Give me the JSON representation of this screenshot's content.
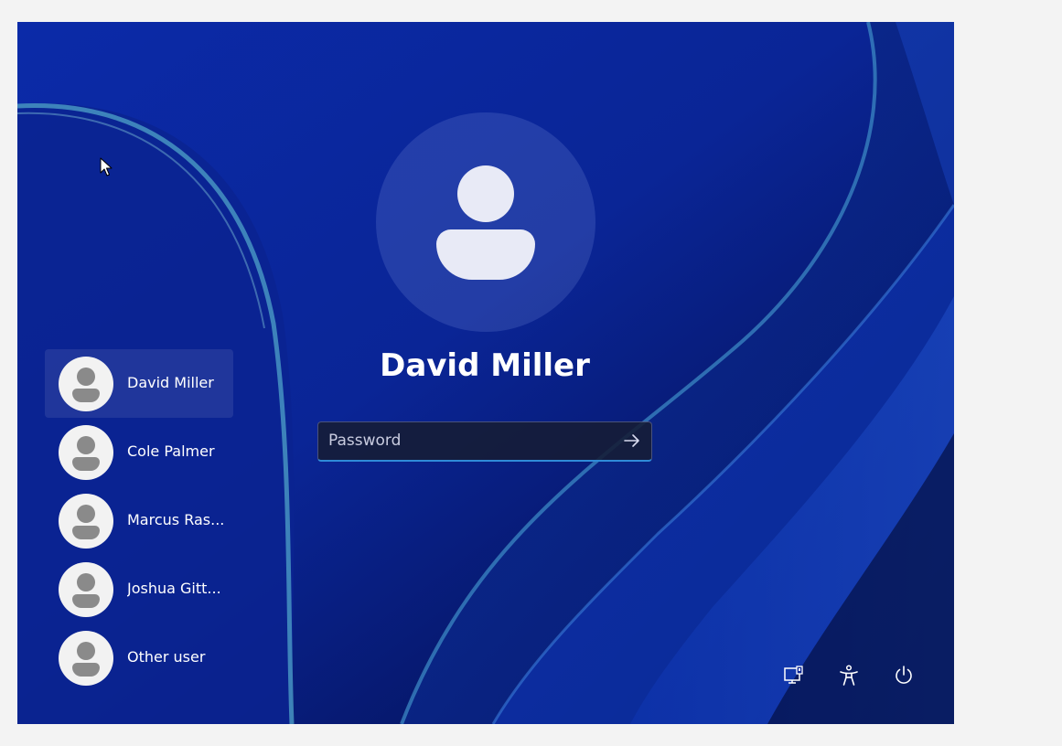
{
  "login": {
    "selected_user": "David Miller",
    "password_placeholder": "Password",
    "password_value": ""
  },
  "users": [
    {
      "label": "David Miller",
      "selected": true
    },
    {
      "label": "Cole Palmer",
      "selected": false
    },
    {
      "label": "Marcus Ras...",
      "selected": false
    },
    {
      "label": "Joshua Gitt...",
      "selected": false
    },
    {
      "label": "Other user",
      "selected": false
    }
  ],
  "system_icons": [
    "network-icon",
    "accessibility-icon",
    "power-icon"
  ],
  "colors": {
    "wallpaper_base": "#0a2596",
    "accent": "#2f8bd8"
  }
}
